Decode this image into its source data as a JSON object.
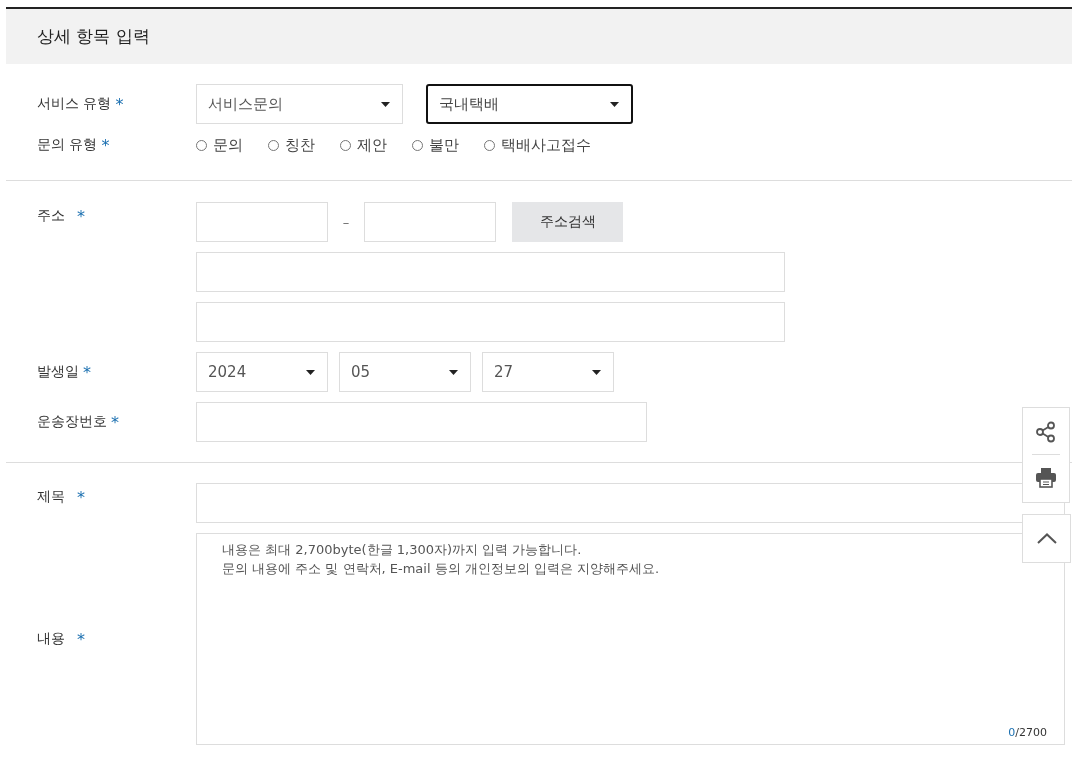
{
  "header": {
    "title": "상세 항목 입력"
  },
  "service_type": {
    "label": "서비스 유형",
    "mark": "*",
    "selects": [
      {
        "value": "서비스문의",
        "focused": false
      },
      {
        "value": "국내택배",
        "focused": true
      }
    ]
  },
  "inquiry_type": {
    "label": "문의 유형",
    "mark": "*",
    "options": [
      {
        "label": "문의",
        "selected": false
      },
      {
        "label": "칭찬",
        "selected": false
      },
      {
        "label": "제안",
        "selected": false
      },
      {
        "label": "불만",
        "selected": false
      },
      {
        "label": "택배사고접수",
        "selected": false
      }
    ]
  },
  "address": {
    "label": "주소",
    "mark": "*",
    "separator": "–",
    "search_button": "주소검색"
  },
  "date": {
    "label": "발생일",
    "mark": "*",
    "selects": [
      {
        "value": "2024"
      },
      {
        "value": "05"
      },
      {
        "value": "27"
      }
    ]
  },
  "tracking": {
    "label": "운송장번호",
    "mark": "*"
  },
  "subject": {
    "label": "제목",
    "mark": "*"
  },
  "content": {
    "label": "내용",
    "mark": "*",
    "placeholder": "내용은 최대 2,700byte(한글 1,300자)까지 입력 가능합니다.\n문의 내용에 주소 및 연락처, E-mail 등의 개인정보의 입력은 지양해주세요.",
    "counter_current": "0",
    "counter_total": "/2700"
  }
}
